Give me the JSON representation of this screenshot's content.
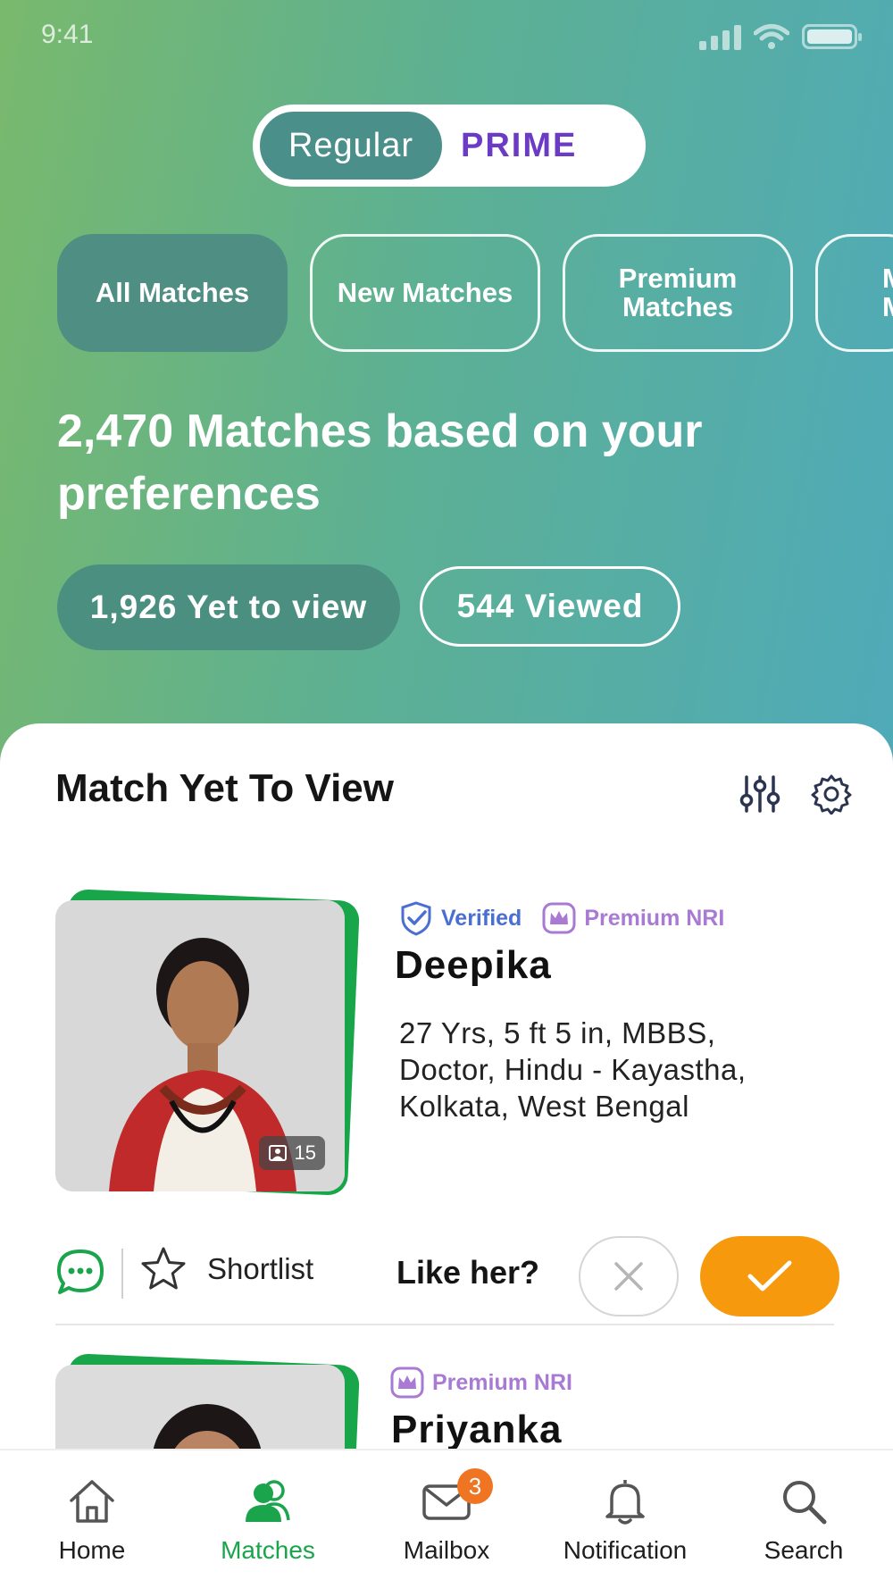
{
  "status_bar": {
    "time": "9:41"
  },
  "plan_toggle": {
    "regular": "Regular",
    "prime": "PRIME"
  },
  "filters": [
    {
      "label": "All Matches",
      "active": true
    },
    {
      "label": "New Matches",
      "active": false
    },
    {
      "label": "Premium Matches",
      "active": false
    },
    {
      "label": "M M",
      "active": false
    }
  ],
  "headline": "2,470 Matches based on your preferences",
  "view_pills": {
    "yet_to_view": "1,926 Yet to view",
    "viewed": "544 Viewed"
  },
  "section": {
    "title": "Match Yet To View",
    "icons": [
      "sliders-icon",
      "gear-icon"
    ]
  },
  "profiles": [
    {
      "name": "Deepika",
      "verified_label": "Verified",
      "premium_label": "Premium NRI",
      "details": "27 Yrs, 5 ft 5 in, MBBS, Doctor, Hindu - Kayastha, Kolkata, West Bengal",
      "photo_count": "15",
      "shortlist_label": "Shortlist",
      "like_prompt": "Like her?"
    },
    {
      "name": "Priyanka",
      "premium_label": "Premium NRI"
    }
  ],
  "bottom_nav": {
    "items": [
      {
        "label": "Home",
        "icon": "home-icon"
      },
      {
        "label": "Matches",
        "icon": "matches-icon",
        "active": true
      },
      {
        "label": "Mailbox",
        "icon": "mail-icon",
        "badge": "3"
      },
      {
        "label": "Notification",
        "icon": "bell-icon"
      },
      {
        "label": "Search",
        "icon": "search-icon"
      }
    ]
  },
  "colors": {
    "accent_green": "#1aa44c",
    "accept_orange": "#f6990c",
    "prime_purple": "#6b3bc4"
  }
}
